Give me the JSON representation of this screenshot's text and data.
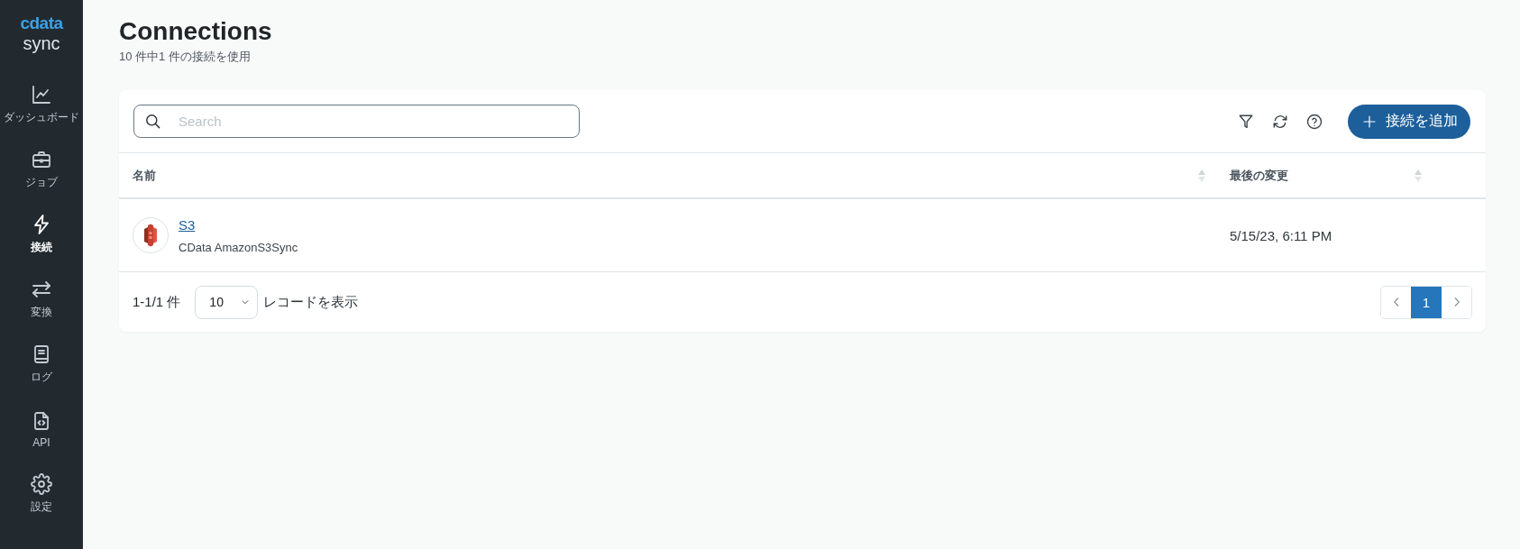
{
  "sidebar": {
    "logo": {
      "brand": "cdata",
      "product": "sync"
    },
    "items": [
      {
        "label": "ダッシュボード",
        "kind": "dashboard",
        "selected": false
      },
      {
        "label": "ジョブ",
        "kind": "jobs",
        "selected": false
      },
      {
        "label": "接続",
        "kind": "connections",
        "selected": true
      },
      {
        "label": "変換",
        "kind": "transform",
        "selected": false
      },
      {
        "label": "ログ",
        "kind": "logs",
        "selected": false
      },
      {
        "label": "API",
        "kind": "api",
        "selected": false
      },
      {
        "label": "設定",
        "kind": "settings",
        "selected": false
      }
    ]
  },
  "page": {
    "title": "Connections",
    "subtitle": "10 件中1 件の接続を使用"
  },
  "toolbar": {
    "search": {
      "placeholder": "Search"
    },
    "add_button": {
      "label": "接続を追加"
    }
  },
  "table": {
    "columns": [
      {
        "label": "名前",
        "sortable": true
      },
      {
        "label": "最後の変更",
        "sortable": true
      }
    ],
    "rows": [
      {
        "name": "S3",
        "connector": "CData AmazonS3Sync",
        "modified": "5/15/23, 6:11 PM"
      }
    ]
  },
  "footer": {
    "range": "1-1/1 件",
    "page_size": "10",
    "page_size_label": "レコードを表示",
    "pages": [
      {
        "label": "1",
        "selected": true
      }
    ]
  }
}
